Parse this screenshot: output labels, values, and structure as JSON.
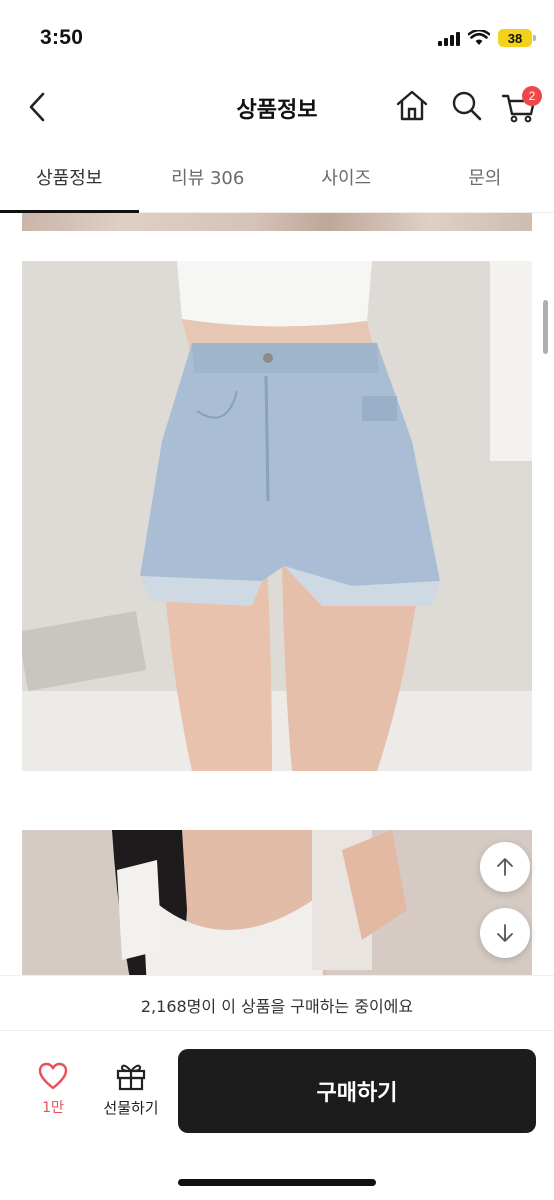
{
  "status": {
    "time": "3:50",
    "battery": "38"
  },
  "header": {
    "title": "상품정보",
    "cart_badge": "2"
  },
  "tabs": [
    {
      "label": "상품정보"
    },
    {
      "label": "리뷰 306"
    },
    {
      "label": "사이즈"
    },
    {
      "label": "문의"
    }
  ],
  "notice": {
    "text": "2,168명이 이 상품을 구매하는 중이에요"
  },
  "bottom": {
    "like_count": "1만",
    "gift_label": "선물하기",
    "buy_label": "구매하기"
  },
  "colors": {
    "badge": "#f04848",
    "like": "#e8505b",
    "buy_button": "#1c1c1c"
  },
  "icons": [
    "back-icon",
    "home-icon",
    "search-icon",
    "cart-icon",
    "heart-icon",
    "gift-icon",
    "arrow-up-icon",
    "arrow-down-icon"
  ]
}
